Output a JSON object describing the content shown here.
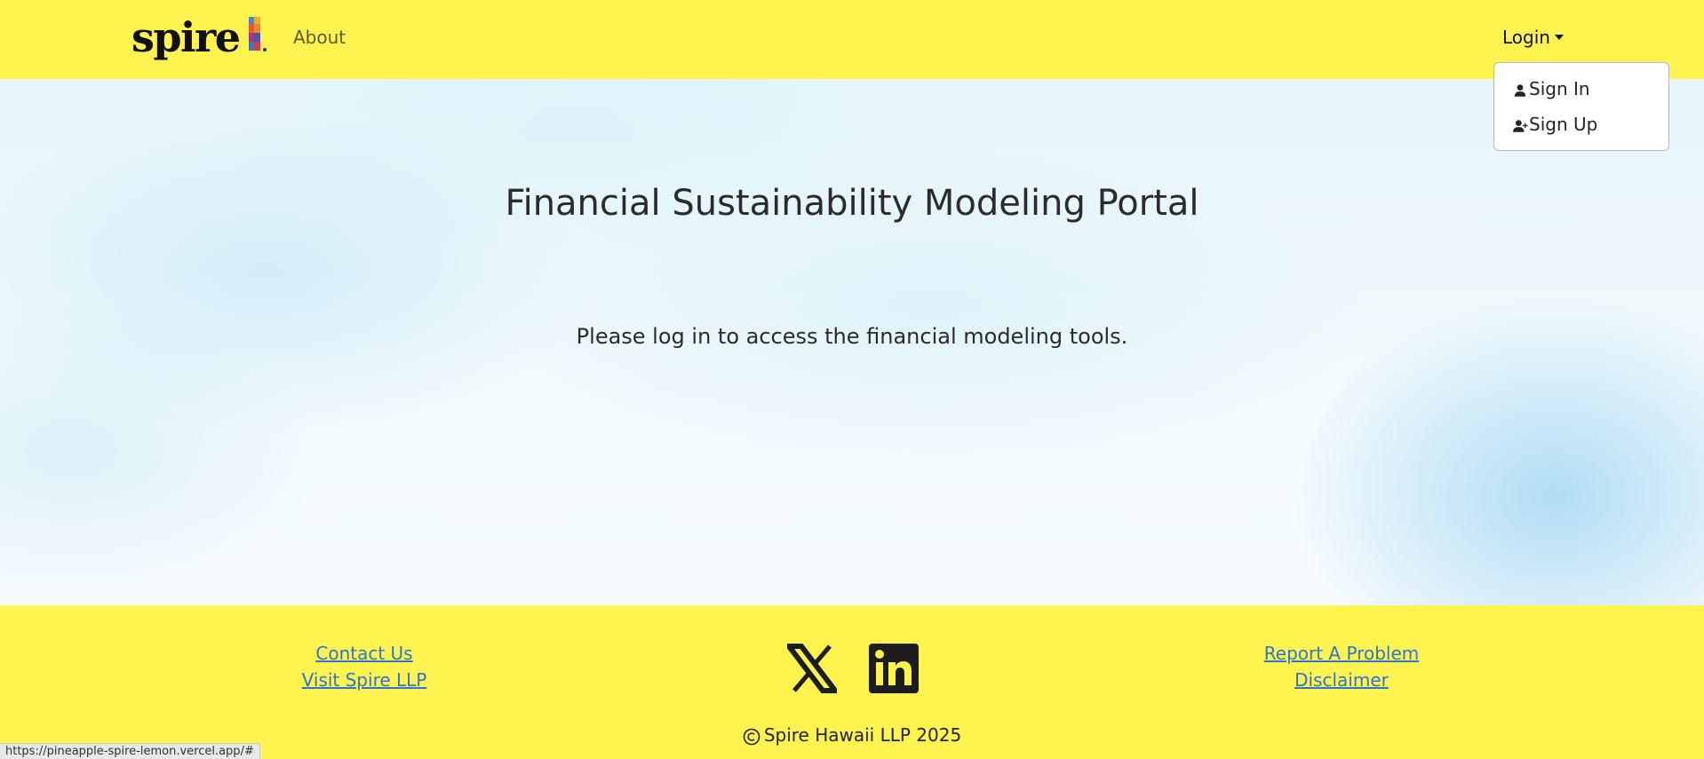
{
  "brand": {
    "name": "spire"
  },
  "nav": {
    "about_label": "About",
    "login_label": "Login"
  },
  "dropdown": {
    "items": [
      {
        "label": "Sign In",
        "icon": "person-icon"
      },
      {
        "label": "Sign Up",
        "icon": "person-plus-icon"
      }
    ]
  },
  "main": {
    "title": "Financial Sustainability Modeling Portal",
    "message": "Please log in to access the financial modeling tools."
  },
  "footer": {
    "left_links": [
      "Contact Us",
      "Visit Spire LLP"
    ],
    "right_links": [
      "Report A Problem",
      "Disclaimer"
    ],
    "social": [
      {
        "name": "x-icon"
      },
      {
        "name": "linkedin-icon"
      }
    ],
    "copyright": "Spire Hawaii LLP 2025"
  },
  "statusbar": {
    "url": "https://pineapple-spire-lemon.vercel.app/#"
  },
  "colors": {
    "header_footer_bg": "#fff34f",
    "link": "#2f74d0",
    "text": "#212529"
  }
}
